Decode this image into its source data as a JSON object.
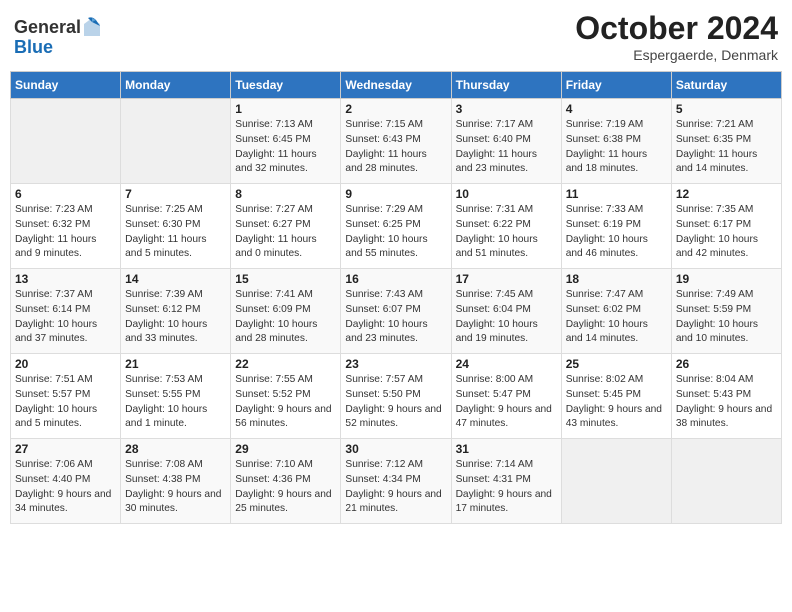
{
  "header": {
    "logo_general": "General",
    "logo_blue": "Blue",
    "title": "October 2024",
    "location": "Espergaerde, Denmark"
  },
  "columns": [
    "Sunday",
    "Monday",
    "Tuesday",
    "Wednesday",
    "Thursday",
    "Friday",
    "Saturday"
  ],
  "weeks": [
    [
      {
        "day": "",
        "empty": true
      },
      {
        "day": "",
        "empty": true
      },
      {
        "day": "1",
        "sunrise": "Sunrise: 7:13 AM",
        "sunset": "Sunset: 6:45 PM",
        "daylight": "Daylight: 11 hours and 32 minutes."
      },
      {
        "day": "2",
        "sunrise": "Sunrise: 7:15 AM",
        "sunset": "Sunset: 6:43 PM",
        "daylight": "Daylight: 11 hours and 28 minutes."
      },
      {
        "day": "3",
        "sunrise": "Sunrise: 7:17 AM",
        "sunset": "Sunset: 6:40 PM",
        "daylight": "Daylight: 11 hours and 23 minutes."
      },
      {
        "day": "4",
        "sunrise": "Sunrise: 7:19 AM",
        "sunset": "Sunset: 6:38 PM",
        "daylight": "Daylight: 11 hours and 18 minutes."
      },
      {
        "day": "5",
        "sunrise": "Sunrise: 7:21 AM",
        "sunset": "Sunset: 6:35 PM",
        "daylight": "Daylight: 11 hours and 14 minutes."
      }
    ],
    [
      {
        "day": "6",
        "sunrise": "Sunrise: 7:23 AM",
        "sunset": "Sunset: 6:32 PM",
        "daylight": "Daylight: 11 hours and 9 minutes."
      },
      {
        "day": "7",
        "sunrise": "Sunrise: 7:25 AM",
        "sunset": "Sunset: 6:30 PM",
        "daylight": "Daylight: 11 hours and 5 minutes."
      },
      {
        "day": "8",
        "sunrise": "Sunrise: 7:27 AM",
        "sunset": "Sunset: 6:27 PM",
        "daylight": "Daylight: 11 hours and 0 minutes."
      },
      {
        "day": "9",
        "sunrise": "Sunrise: 7:29 AM",
        "sunset": "Sunset: 6:25 PM",
        "daylight": "Daylight: 10 hours and 55 minutes."
      },
      {
        "day": "10",
        "sunrise": "Sunrise: 7:31 AM",
        "sunset": "Sunset: 6:22 PM",
        "daylight": "Daylight: 10 hours and 51 minutes."
      },
      {
        "day": "11",
        "sunrise": "Sunrise: 7:33 AM",
        "sunset": "Sunset: 6:19 PM",
        "daylight": "Daylight: 10 hours and 46 minutes."
      },
      {
        "day": "12",
        "sunrise": "Sunrise: 7:35 AM",
        "sunset": "Sunset: 6:17 PM",
        "daylight": "Daylight: 10 hours and 42 minutes."
      }
    ],
    [
      {
        "day": "13",
        "sunrise": "Sunrise: 7:37 AM",
        "sunset": "Sunset: 6:14 PM",
        "daylight": "Daylight: 10 hours and 37 minutes."
      },
      {
        "day": "14",
        "sunrise": "Sunrise: 7:39 AM",
        "sunset": "Sunset: 6:12 PM",
        "daylight": "Daylight: 10 hours and 33 minutes."
      },
      {
        "day": "15",
        "sunrise": "Sunrise: 7:41 AM",
        "sunset": "Sunset: 6:09 PM",
        "daylight": "Daylight: 10 hours and 28 minutes."
      },
      {
        "day": "16",
        "sunrise": "Sunrise: 7:43 AM",
        "sunset": "Sunset: 6:07 PM",
        "daylight": "Daylight: 10 hours and 23 minutes."
      },
      {
        "day": "17",
        "sunrise": "Sunrise: 7:45 AM",
        "sunset": "Sunset: 6:04 PM",
        "daylight": "Daylight: 10 hours and 19 minutes."
      },
      {
        "day": "18",
        "sunrise": "Sunrise: 7:47 AM",
        "sunset": "Sunset: 6:02 PM",
        "daylight": "Daylight: 10 hours and 14 minutes."
      },
      {
        "day": "19",
        "sunrise": "Sunrise: 7:49 AM",
        "sunset": "Sunset: 5:59 PM",
        "daylight": "Daylight: 10 hours and 10 minutes."
      }
    ],
    [
      {
        "day": "20",
        "sunrise": "Sunrise: 7:51 AM",
        "sunset": "Sunset: 5:57 PM",
        "daylight": "Daylight: 10 hours and 5 minutes."
      },
      {
        "day": "21",
        "sunrise": "Sunrise: 7:53 AM",
        "sunset": "Sunset: 5:55 PM",
        "daylight": "Daylight: 10 hours and 1 minute."
      },
      {
        "day": "22",
        "sunrise": "Sunrise: 7:55 AM",
        "sunset": "Sunset: 5:52 PM",
        "daylight": "Daylight: 9 hours and 56 minutes."
      },
      {
        "day": "23",
        "sunrise": "Sunrise: 7:57 AM",
        "sunset": "Sunset: 5:50 PM",
        "daylight": "Daylight: 9 hours and 52 minutes."
      },
      {
        "day": "24",
        "sunrise": "Sunrise: 8:00 AM",
        "sunset": "Sunset: 5:47 PM",
        "daylight": "Daylight: 9 hours and 47 minutes."
      },
      {
        "day": "25",
        "sunrise": "Sunrise: 8:02 AM",
        "sunset": "Sunset: 5:45 PM",
        "daylight": "Daylight: 9 hours and 43 minutes."
      },
      {
        "day": "26",
        "sunrise": "Sunrise: 8:04 AM",
        "sunset": "Sunset: 5:43 PM",
        "daylight": "Daylight: 9 hours and 38 minutes."
      }
    ],
    [
      {
        "day": "27",
        "sunrise": "Sunrise: 7:06 AM",
        "sunset": "Sunset: 4:40 PM",
        "daylight": "Daylight: 9 hours and 34 minutes."
      },
      {
        "day": "28",
        "sunrise": "Sunrise: 7:08 AM",
        "sunset": "Sunset: 4:38 PM",
        "daylight": "Daylight: 9 hours and 30 minutes."
      },
      {
        "day": "29",
        "sunrise": "Sunrise: 7:10 AM",
        "sunset": "Sunset: 4:36 PM",
        "daylight": "Daylight: 9 hours and 25 minutes."
      },
      {
        "day": "30",
        "sunrise": "Sunrise: 7:12 AM",
        "sunset": "Sunset: 4:34 PM",
        "daylight": "Daylight: 9 hours and 21 minutes."
      },
      {
        "day": "31",
        "sunrise": "Sunrise: 7:14 AM",
        "sunset": "Sunset: 4:31 PM",
        "daylight": "Daylight: 9 hours and 17 minutes."
      },
      {
        "day": "",
        "empty": true
      },
      {
        "day": "",
        "empty": true
      }
    ]
  ]
}
